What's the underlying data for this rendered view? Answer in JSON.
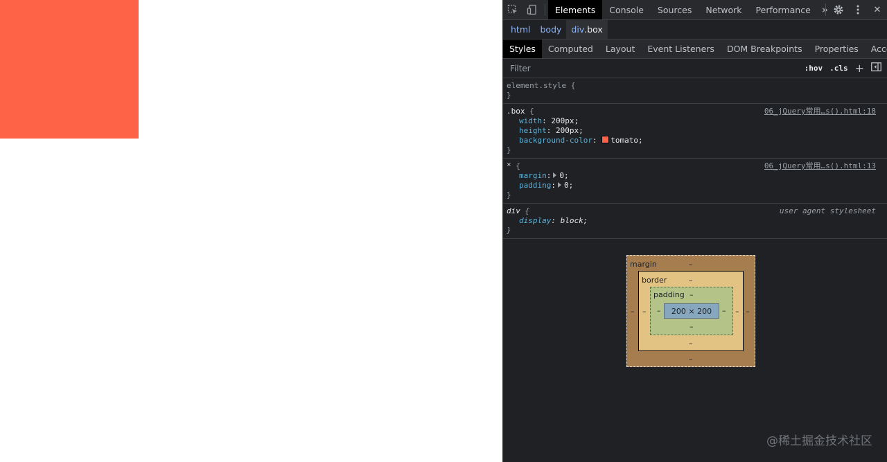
{
  "page": {
    "box_color": "#ff6347"
  },
  "toolbar": {
    "tabs": [
      {
        "label": "Elements"
      },
      {
        "label": "Console"
      },
      {
        "label": "Sources"
      },
      {
        "label": "Network"
      },
      {
        "label": "Performance"
      }
    ],
    "more": "»",
    "settings_icon": "gear-icon",
    "menu_icon": "kebab-icon",
    "close": "✕"
  },
  "breadcrumb": {
    "items": [
      {
        "label": "html"
      },
      {
        "label": "body"
      },
      {
        "tag": "div",
        "cls": ".box"
      }
    ]
  },
  "subtabs": [
    {
      "label": "Styles"
    },
    {
      "label": "Computed"
    },
    {
      "label": "Layout"
    },
    {
      "label": "Event Listeners"
    },
    {
      "label": "DOM Breakpoints"
    },
    {
      "label": "Properties"
    },
    {
      "label": "Accessibility"
    }
  ],
  "filter": {
    "placeholder": "Filter",
    "hov": ":hov",
    "cls": ".cls",
    "plus": "+"
  },
  "rules": {
    "element_style": {
      "selector": "element.style",
      "open": "{",
      "close": "}"
    },
    "box": {
      "selector": ".box",
      "open": "{",
      "close": "}",
      "source": "06_jQuery常用…s().html:18",
      "decls": [
        {
          "name": "width",
          "value": "200px;"
        },
        {
          "name": "height",
          "value": "200px;"
        },
        {
          "name": "background-color",
          "value": "tomato;"
        }
      ]
    },
    "star": {
      "selector": "*",
      "open": "{",
      "close": "}",
      "source": "06_jQuery常用…s().html:13",
      "decls": [
        {
          "name": "margin",
          "value": "0;"
        },
        {
          "name": "padding",
          "value": "0;"
        }
      ]
    },
    "div": {
      "selector": "div",
      "open": "{",
      "close": "}",
      "source": "user agent stylesheet",
      "decls": [
        {
          "name": "display",
          "value": "block;"
        }
      ]
    }
  },
  "colon": ":",
  "boxmodel": {
    "margin_label": "margin",
    "border_label": "border",
    "padding_label": "padding",
    "content": "200 × 200",
    "dash": "–"
  },
  "watermark": "@稀土掘金技术社区"
}
